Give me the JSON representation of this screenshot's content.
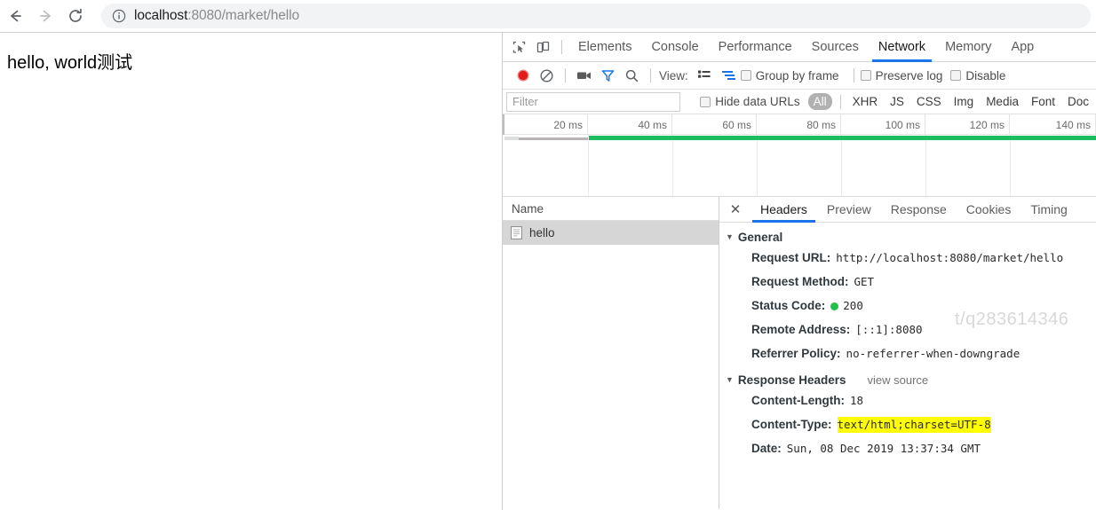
{
  "browser": {
    "back_label": "Back",
    "forward_label": "Forward",
    "reload_label": "Reload",
    "site_info_icon": "info-circle-icon",
    "url_host": "localhost",
    "url_path": ":8080/market/hello",
    "url_full": "localhost:8080/market/hello"
  },
  "page": {
    "body_text": "hello, world测试"
  },
  "devtools": {
    "inspect_icon": "inspect-element-icon",
    "device_icon": "device-toolbar-icon",
    "tabs": [
      {
        "label": "Elements",
        "active": false
      },
      {
        "label": "Console",
        "active": false
      },
      {
        "label": "Performance",
        "active": false
      },
      {
        "label": "Sources",
        "active": false
      },
      {
        "label": "Network",
        "active": true
      },
      {
        "label": "Memory",
        "active": false
      },
      {
        "label": "App",
        "active": false
      }
    ],
    "accent_color": "#1a73e8",
    "toolbar": {
      "record_icon": "record-button-icon",
      "clear_icon": "clear-icon",
      "camera_icon": "screenshot-camera-icon",
      "filter_icon": "filter-funnel-icon",
      "search_icon": "search-icon",
      "view_label": "View:",
      "view_list_icon": "list-view-icon",
      "view_waterfall_icon": "waterfall-view-icon",
      "group_by_frame_label": "Group by frame",
      "preserve_log_label": "Preserve log",
      "disable_label": "Disable"
    },
    "filterbar": {
      "filter_placeholder": "Filter",
      "filter_value": "",
      "hide_data_urls_label": "Hide data URLs",
      "types": [
        {
          "label": "All",
          "active": true
        },
        {
          "label": "XHR",
          "active": false
        },
        {
          "label": "JS",
          "active": false
        },
        {
          "label": "CSS",
          "active": false
        },
        {
          "label": "Img",
          "active": false
        },
        {
          "label": "Media",
          "active": false
        },
        {
          "label": "Font",
          "active": false
        },
        {
          "label": "Doc",
          "active": false
        }
      ]
    },
    "overview": {
      "ticks": [
        "20 ms",
        "40 ms",
        "60 ms",
        "80 ms",
        "100 ms",
        "120 ms",
        "140 ms"
      ],
      "bar_color": "#1bbd5e"
    },
    "requests": {
      "column_header": "Name",
      "rows": [
        {
          "name": "hello",
          "icon": "document-icon",
          "selected": true
        }
      ]
    },
    "details": {
      "close_icon": "close-icon",
      "tabs": [
        {
          "label": "Headers",
          "active": true
        },
        {
          "label": "Preview",
          "active": false
        },
        {
          "label": "Response",
          "active": false
        },
        {
          "label": "Cookies",
          "active": false
        },
        {
          "label": "Timing",
          "active": false
        }
      ],
      "general": {
        "title": "General",
        "rows": [
          {
            "name": "Request URL:",
            "value": "http://localhost:8080/market/hello"
          },
          {
            "name": "Request Method:",
            "value": "GET"
          },
          {
            "name": "Status Code:",
            "value": "200",
            "status_dot": true
          },
          {
            "name": "Remote Address:",
            "value": "[::1]:8080"
          },
          {
            "name": "Referrer Policy:",
            "value": "no-referrer-when-downgrade"
          }
        ]
      },
      "response_headers": {
        "title": "Response Headers",
        "view_source_label": "view source",
        "rows": [
          {
            "name": "Content-Length:",
            "value": "18"
          },
          {
            "name": "Content-Type:",
            "value": "text/html;charset=UTF-8",
            "highlight": true
          },
          {
            "name": "Date:",
            "value": "Sun, 08 Dec 2019 13:37:34 GMT"
          }
        ]
      },
      "watermark_text": "t/q283614346"
    }
  }
}
